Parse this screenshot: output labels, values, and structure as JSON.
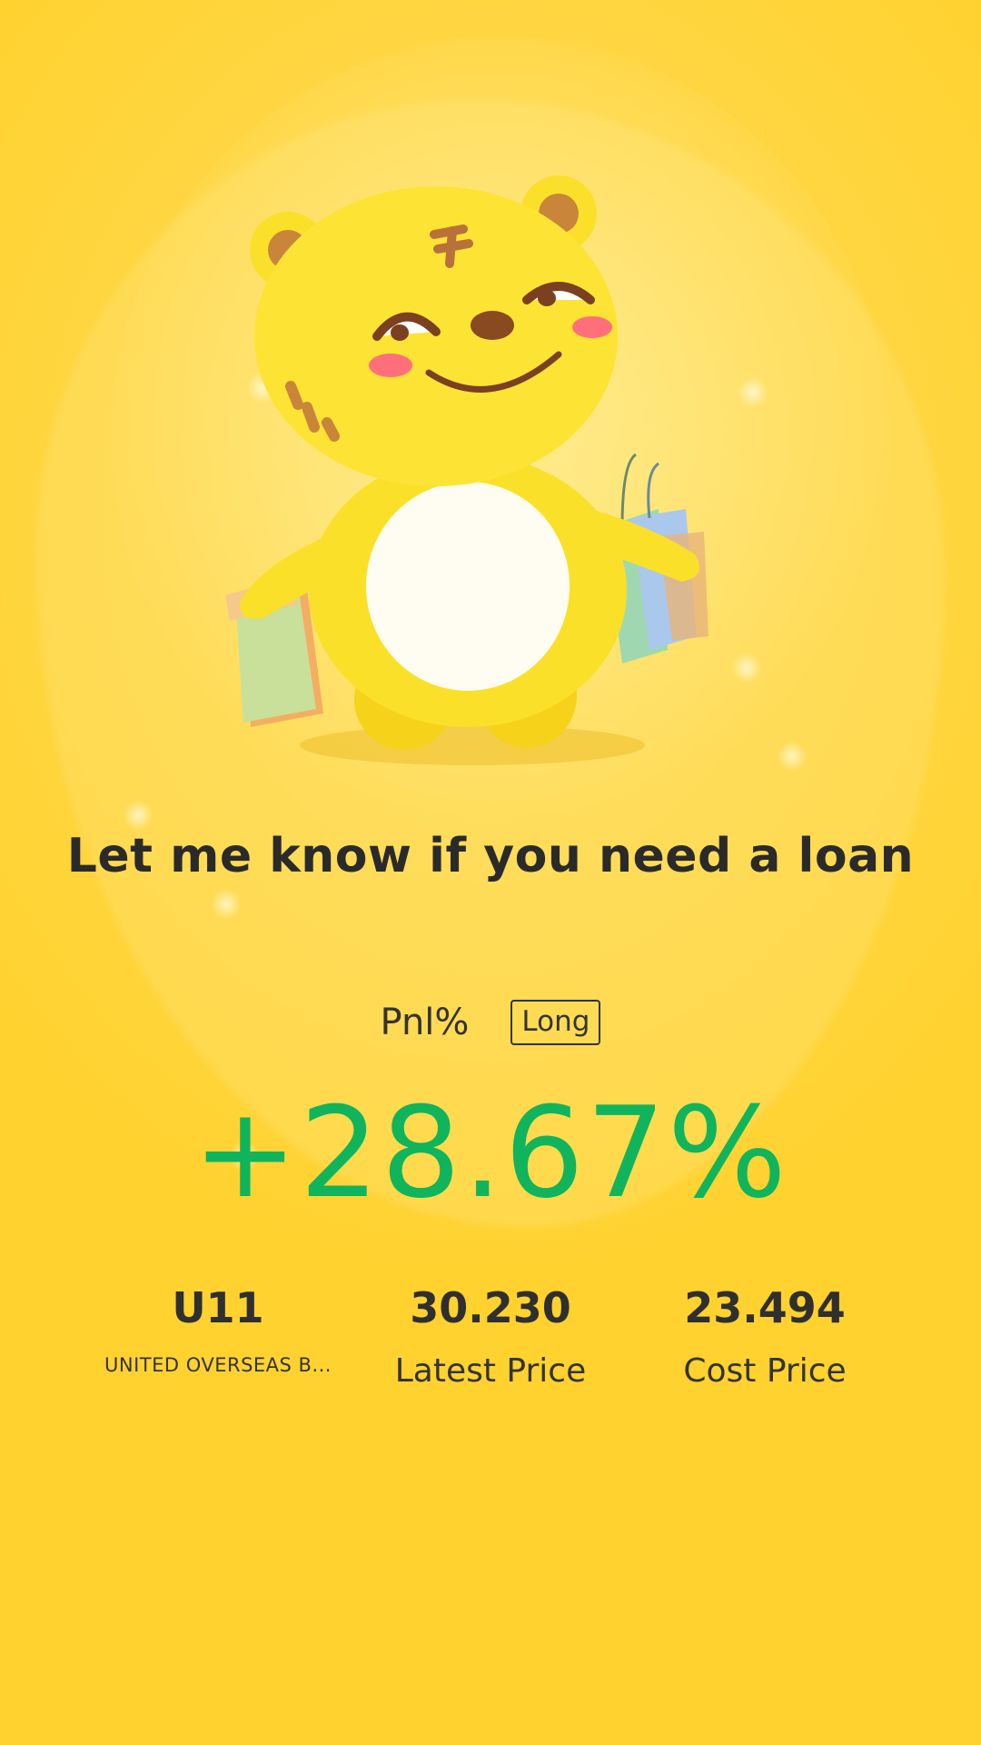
{
  "headline": "Let me know if you need a loan",
  "pnl": {
    "label": "Pnl%",
    "direction_tag": "Long",
    "value": "+28.67%",
    "value_color": "#10b45c"
  },
  "stats": {
    "symbol": "U11",
    "symbol_name": "UNITED OVERSEAS B...",
    "latest_price": "30.230",
    "latest_price_label": "Latest Price",
    "cost_price": "23.494",
    "cost_price_label": "Cost Price"
  },
  "mascot": {
    "icon": "tiger-mascot-with-shopping-bags-icon"
  },
  "colors": {
    "background": "#ffd84a",
    "text": "#2a2a2a",
    "profit": "#10b45c"
  }
}
